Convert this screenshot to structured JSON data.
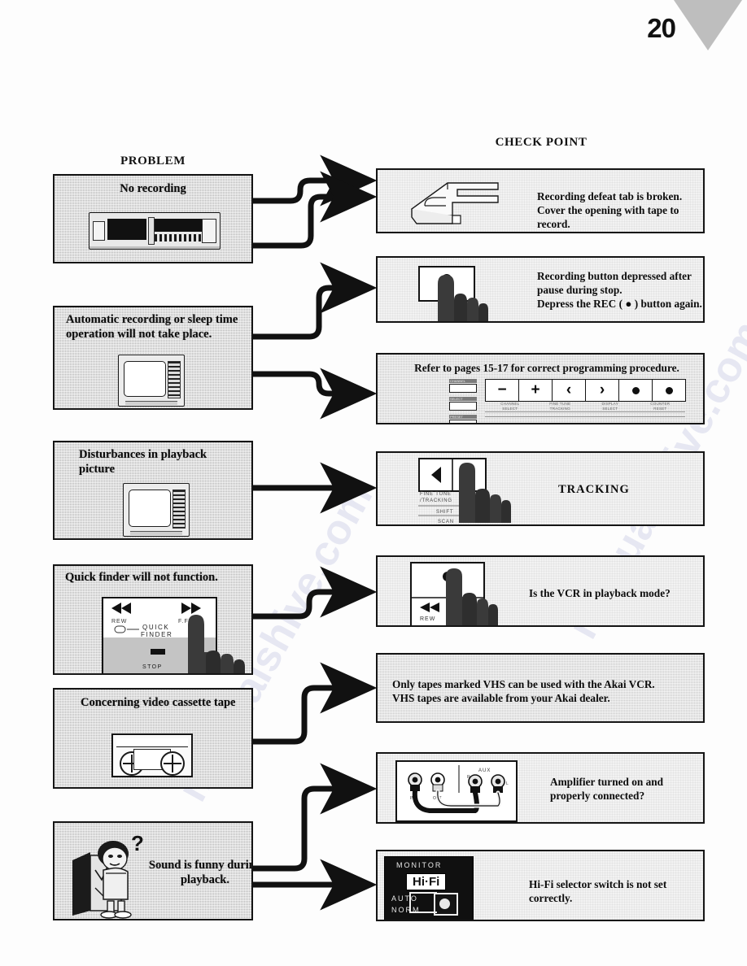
{
  "page": {
    "number": "20"
  },
  "headings": {
    "problem": "PROBLEM",
    "check_point": "CHECK POINT"
  },
  "problems": [
    {
      "id": "no-recording",
      "title": "No recording",
      "illustration": "vcr-front-panel"
    },
    {
      "id": "auto-recording",
      "title": "Automatic recording or sleep time operation will  not take place.",
      "illustration": "television-set"
    },
    {
      "id": "disturbances",
      "title": "Disturbances in playback picture",
      "illustration": "television-set"
    },
    {
      "id": "quick-finder",
      "title": "Quick finder will not function.",
      "illustration": "quick-finder-panel-with-hand",
      "panel_labels": [
        "REW",
        "F.FWD",
        "QUICK",
        "FINDER",
        "STOP"
      ]
    },
    {
      "id": "video-cassette",
      "title": "Concerning video cassette tape",
      "illustration": "vhs-cassette"
    },
    {
      "id": "sound-funny",
      "title": "Sound is funny during playback.",
      "illustration": "confused-person-with-television"
    }
  ],
  "checkpoints": [
    {
      "id": "defeat-tab",
      "text": "Recording defeat tab is broken.\nCover the opening with tape to record.",
      "illustration": "cassette-shell-tab"
    },
    {
      "id": "rec-button",
      "text": "Recording button depressed after pause during stop.\nDepress the REC ( ● ) button again.",
      "illustration": "rec-button-with-hand"
    },
    {
      "id": "programming",
      "text": "Refer to pages 15-17 for correct programming procedure.",
      "illustration": "program-key-row",
      "keys": [
        "−",
        "+",
        "‹",
        "›",
        "●",
        "●"
      ],
      "key_labels": [
        "CHANNEL\nSELECT",
        "FINE TUNE\nTRACKING",
        "DISPLAY\nSELECT",
        "COUNTER\nRESET"
      ],
      "side_labels": [
        "CHANNEL",
        "SELECT",
        "PRESET"
      ]
    },
    {
      "id": "tracking",
      "text": "TRACKING",
      "illustration": "tracking-keys-with-hand",
      "panel_labels": [
        "FINE TUNE",
        "/TRACKING",
        "SHIFT",
        "SCAN"
      ]
    },
    {
      "id": "playback-mode",
      "text": "Is the VCR in playback mode?",
      "illustration": "play-button-with-hand",
      "panel_labels": [
        "REW"
      ]
    },
    {
      "id": "vhs-tapes",
      "text": "Only tapes  marked  VHS  can  be  used  with  the  Akai VCR.\nVHS tapes are available from your Akai dealer.",
      "illustration": "none"
    },
    {
      "id": "amplifier",
      "text": "Amplifier turned on and properly connected?",
      "illustration": "rca-cables",
      "panel_labels": [
        "AUX",
        "R",
        "L",
        "IN",
        "OUT"
      ]
    },
    {
      "id": "hifi-switch",
      "text": "Hi-Fi selector switch is not set correctly.",
      "illustration": "hifi-selector",
      "panel_labels": [
        "MONITOR",
        "Hi·Fi",
        "AUTO",
        "NORM"
      ]
    }
  ],
  "watermark": {
    "text": "manualshive.com"
  },
  "colors": {
    "ink": "#111111",
    "problem_fill": "#b4b4b4",
    "check_fill": "#f2f2f2",
    "corner": "#b9b9b9"
  }
}
